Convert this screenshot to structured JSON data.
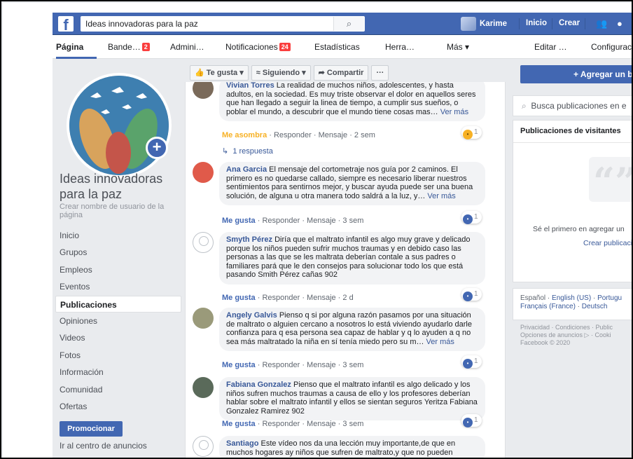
{
  "topbar": {
    "search_value": "Ideas innovadoras para la paz",
    "user_name": "Karime",
    "home_label": "Inicio",
    "create_label": "Crear"
  },
  "page_nav": {
    "items": [
      "Página",
      "Bande…",
      "Admini…",
      "Notificaciones",
      "Estadísticas",
      "Herra…",
      "Más ▾",
      "Editar …",
      "Configurac"
    ],
    "inbox_badge": "2",
    "notif_badge": "24"
  },
  "page": {
    "name": "Ideas innovadoras para la paz",
    "username_link": "Crear nombre de usuario de la página"
  },
  "left_nav": {
    "items": [
      "Inicio",
      "Grupos",
      "Empleos",
      "Eventos",
      "Publicaciones",
      "Opiniones",
      "Videos",
      "Fotos",
      "Información",
      "Comunidad",
      "Ofertas"
    ],
    "promote_label": "Promocionar",
    "ads_center_label": "Ir al centro de anuncios"
  },
  "action_bar": {
    "like": "Te gusta ▾",
    "following": "Siguiendo ▾",
    "share": "Compartir",
    "more": "···"
  },
  "comments": [
    {
      "author": "Vivian Torres",
      "text": " La realidad de muchos niños, adolescentes, y hasta adultos, en la sociedad. Es muy triste observar el dolor en aquellos seres que han llegado a seguir la linea de tiempo, a cumplir sus sueños, o poblar el mundo, a descubrir que el mundo tiene cosas mas… ",
      "more": "Ver más",
      "reaction_label": "Me asombra",
      "actions": " · Responder · Mensaje · 2 sem",
      "reaction_count": "1",
      "replies": "1 respuesta"
    },
    {
      "author": "Ana Garcia",
      "text": " El mensaje del cortometraje nos guía por 2 caminos. El primero es no quedarse callado, siempre es necesario liberar nuestros sentimientos para sentirnos mejor, y buscar ayuda puede ser una buena solución, de alguna u otra manera todo saldrá a la luz, y… ",
      "more": "Ver más",
      "reaction_label": "Me gusta",
      "actions": " · Responder · Mensaje · 3 sem",
      "reaction_count": "1"
    },
    {
      "author": "Smyth Pérez",
      "text": " Diría que el maltrato infantil es algo muy grave y delicado porque los niños pueden sufrir muchos traumas y en debido caso las personas a las que se les maltrata deberían contale a sus padres o familiares pará que le den consejos para solucionar todo los que está pasando Smith Pérez cañas 902",
      "more": "",
      "reaction_label": "Me gusta",
      "actions": " · Responder · Mensaje · 2 d",
      "reaction_count": "1"
    },
    {
      "author": "Angely Galvis",
      "text": " Pienso q si por alguna razón pasamos por una situación de maltrato o alguien cercano a nosotros lo está viviendo ayudarlo darle confianza para q esa persona sea capaz de hablar y q lo ayuden a q no sea más maltratado la niña en sí tenía miedo pero su m… ",
      "more": "Ver más",
      "reaction_label": "Me gusta",
      "actions": " · Responder · Mensaje · 3 sem",
      "reaction_count": "1"
    },
    {
      "author": "Fabiana Gonzalez",
      "text": " Pienso que el maltrato infantil es algo delicado y los niños sufren muchos traumas a causa de ello y los profesores deberían hablar sobre el maltrato infantil y ellos se sientan seguros Yeritza Fabiana Gonzalez Ramirez 902",
      "more": "",
      "reaction_label": "Me gusta",
      "actions": " · Responder · Mensaje · 3 sem",
      "reaction_count": "1"
    },
    {
      "author": "Santiago",
      "text": " Este vídeo nos da una lección muy importante,de que en muchos hogares ay niños que sufren de maltrato,y que no pueden",
      "more": "",
      "reaction_label": "",
      "actions": "",
      "reaction_count": ""
    }
  ],
  "right": {
    "add_button": "+ Agregar un b",
    "search_placeholder": "Busca publicaciones en e",
    "visitors_title": "Publicaciones de visitantes",
    "visitors_empty": "Sé el primero en agregar un",
    "visitors_create": "Crear publicació",
    "languages_current": "Español",
    "languages": [
      "English (US)",
      "Portugu",
      "Français (France)",
      "Deutsch"
    ],
    "footer_line1": "Privacidad · Condiciones · Public",
    "footer_line2": "Opciones de anuncios ▷ · Cooki",
    "footer_line3": "Facebook © 2020"
  },
  "colors": {
    "brand": "#4267b2",
    "badge": "#fa3e3e",
    "link": "#385898",
    "wow": "#f7b125"
  },
  "icons": {
    "logo": "facebook-logo-icon",
    "search": "search-icon",
    "friends": "friends-icon",
    "messenger": "messenger-icon",
    "plus": "plus-icon",
    "reply_arrow": "reply-arrow-icon"
  }
}
